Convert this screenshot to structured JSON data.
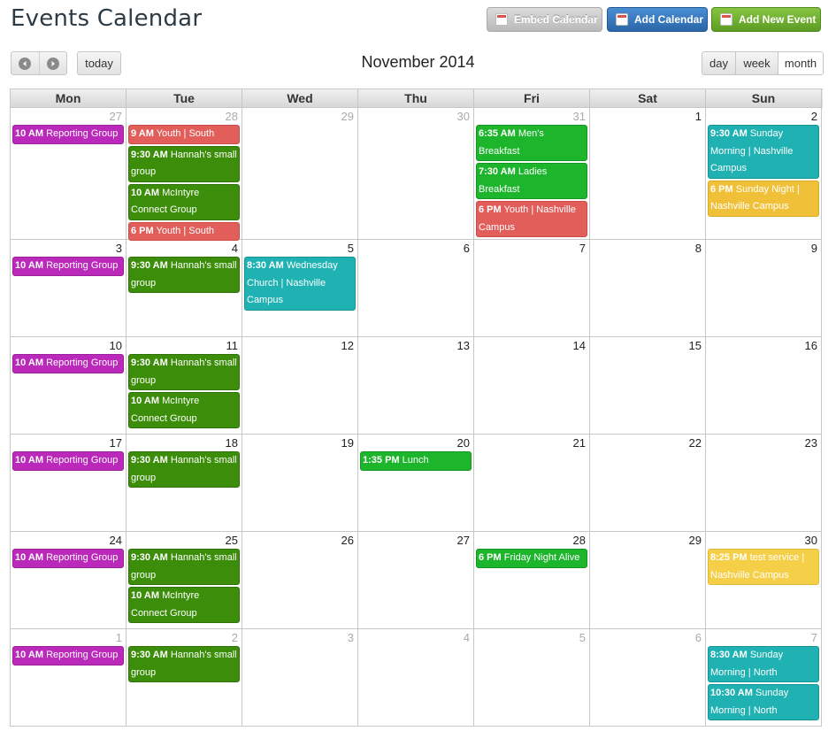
{
  "title": "Events Calendar",
  "top_buttons": {
    "embed_label": "Embed Calendar",
    "add_calendar_label": "Add Calendar",
    "add_event_label": "Add New Event"
  },
  "toolbar": {
    "prev_icon": "chevron-left-icon",
    "next_icon": "chevron-right-icon",
    "today_label": "today",
    "month_title": "November 2014",
    "views": [
      "day",
      "week",
      "month"
    ],
    "active_view": "month"
  },
  "weekdays": [
    "Mon",
    "Tue",
    "Wed",
    "Thu",
    "Fri",
    "Sat",
    "Sun"
  ],
  "colors": {
    "purple": "#bb29bb",
    "green": "#3c8e0a",
    "bright_green": "#1cb52c",
    "red": "#e15e5b",
    "teal": "#20b2b2",
    "yellow": "#f0c038"
  },
  "weeks": [
    {
      "days": [
        {
          "num": "27",
          "other": true,
          "events": [
            {
              "time": "10 AM",
              "title": "Reporting Group",
              "color": "purple"
            }
          ]
        },
        {
          "num": "28",
          "other": true,
          "events": [
            {
              "time": "9 AM",
              "title": "Youth | South",
              "color": "red"
            },
            {
              "time": "9:30 AM",
              "title": "Hannah's small group",
              "color": "green"
            },
            {
              "time": "10 AM",
              "title": "McIntyre Connect Group",
              "color": "green"
            },
            {
              "time": "6 PM",
              "title": "Youth | South",
              "color": "red"
            }
          ]
        },
        {
          "num": "29",
          "other": true,
          "events": []
        },
        {
          "num": "30",
          "other": true,
          "events": []
        },
        {
          "num": "31",
          "other": true,
          "events": [
            {
              "time": "6:35 AM",
              "title": "Men's Breakfast",
              "color": "bgreen"
            },
            {
              "time": "7:30 AM",
              "title": "Ladies Breakfast",
              "color": "bgreen"
            },
            {
              "time": "6 PM",
              "title": "Youth | Nashville Campus",
              "color": "red"
            }
          ]
        },
        {
          "num": "1",
          "other": false,
          "events": []
        },
        {
          "num": "2",
          "other": false,
          "events": [
            {
              "time": "9:30 AM",
              "title": "Sunday Morning | Nashville Campus",
              "color": "teal"
            },
            {
              "time": "6 PM",
              "title": "Sunday Night | Nashville Campus",
              "color": "yellow"
            }
          ]
        }
      ]
    },
    {
      "days": [
        {
          "num": "3",
          "other": false,
          "events": [
            {
              "time": "10 AM",
              "title": "Reporting Group",
              "color": "purple"
            }
          ]
        },
        {
          "num": "4",
          "other": false,
          "events": [
            {
              "time": "9:30 AM",
              "title": "Hannah's small group",
              "color": "green"
            }
          ]
        },
        {
          "num": "5",
          "other": false,
          "events": [
            {
              "time": "8:30 AM",
              "title": "Wednesday Church | Nashville Campus",
              "color": "teal"
            }
          ]
        },
        {
          "num": "6",
          "other": false,
          "events": []
        },
        {
          "num": "7",
          "other": false,
          "events": []
        },
        {
          "num": "8",
          "other": false,
          "events": []
        },
        {
          "num": "9",
          "other": false,
          "events": []
        }
      ]
    },
    {
      "days": [
        {
          "num": "10",
          "other": false,
          "events": [
            {
              "time": "10 AM",
              "title": "Reporting Group",
              "color": "purple"
            }
          ]
        },
        {
          "num": "11",
          "other": false,
          "events": [
            {
              "time": "9:30 AM",
              "title": "Hannah's small group",
              "color": "green"
            },
            {
              "time": "10 AM",
              "title": "McIntyre Connect Group",
              "color": "green"
            }
          ]
        },
        {
          "num": "12",
          "other": false,
          "events": []
        },
        {
          "num": "13",
          "other": false,
          "events": []
        },
        {
          "num": "14",
          "other": false,
          "events": []
        },
        {
          "num": "15",
          "other": false,
          "events": []
        },
        {
          "num": "16",
          "other": false,
          "events": []
        }
      ]
    },
    {
      "days": [
        {
          "num": "17",
          "other": false,
          "events": [
            {
              "time": "10 AM",
              "title": "Reporting Group",
              "color": "purple"
            }
          ]
        },
        {
          "num": "18",
          "other": false,
          "events": [
            {
              "time": "9:30 AM",
              "title": "Hannah's small group",
              "color": "green"
            }
          ]
        },
        {
          "num": "19",
          "other": false,
          "events": []
        },
        {
          "num": "20",
          "other": false,
          "events": [
            {
              "time": "1:35 PM",
              "title": "Lunch",
              "color": "bgreen"
            }
          ]
        },
        {
          "num": "21",
          "other": false,
          "events": []
        },
        {
          "num": "22",
          "other": false,
          "events": []
        },
        {
          "num": "23",
          "other": false,
          "events": []
        }
      ]
    },
    {
      "days": [
        {
          "num": "24",
          "other": false,
          "events": [
            {
              "time": "10 AM",
              "title": "Reporting Group",
              "color": "purple"
            }
          ]
        },
        {
          "num": "25",
          "other": false,
          "events": [
            {
              "time": "9:30 AM",
              "title": "Hannah's small group",
              "color": "green"
            },
            {
              "time": "10 AM",
              "title": "McIntyre Connect Group",
              "color": "green"
            }
          ]
        },
        {
          "num": "26",
          "other": false,
          "events": []
        },
        {
          "num": "27",
          "other": false,
          "events": []
        },
        {
          "num": "28",
          "other": false,
          "events": [
            {
              "time": "6 PM",
              "title": "Friday Night Alive",
              "color": "bgreen"
            }
          ]
        },
        {
          "num": "29",
          "other": false,
          "events": []
        },
        {
          "num": "30",
          "other": false,
          "events": [
            {
              "time": "8:25 PM",
              "title": "test service | Nashville Campus",
              "color": "yellow2"
            }
          ]
        }
      ]
    },
    {
      "days": [
        {
          "num": "1",
          "other": true,
          "events": [
            {
              "time": "10 AM",
              "title": "Reporting Group",
              "color": "purple"
            }
          ]
        },
        {
          "num": "2",
          "other": true,
          "events": [
            {
              "time": "9:30 AM",
              "title": "Hannah's small group",
              "color": "green"
            }
          ]
        },
        {
          "num": "3",
          "other": true,
          "events": []
        },
        {
          "num": "4",
          "other": true,
          "events": []
        },
        {
          "num": "5",
          "other": true,
          "events": []
        },
        {
          "num": "6",
          "other": true,
          "events": []
        },
        {
          "num": "7",
          "other": true,
          "events": [
            {
              "time": "8:30 AM",
              "title": "Sunday Morning | North",
              "color": "teal"
            },
            {
              "time": "10:30 AM",
              "title": "Sunday Morning | North",
              "color": "teal"
            }
          ]
        }
      ]
    }
  ]
}
